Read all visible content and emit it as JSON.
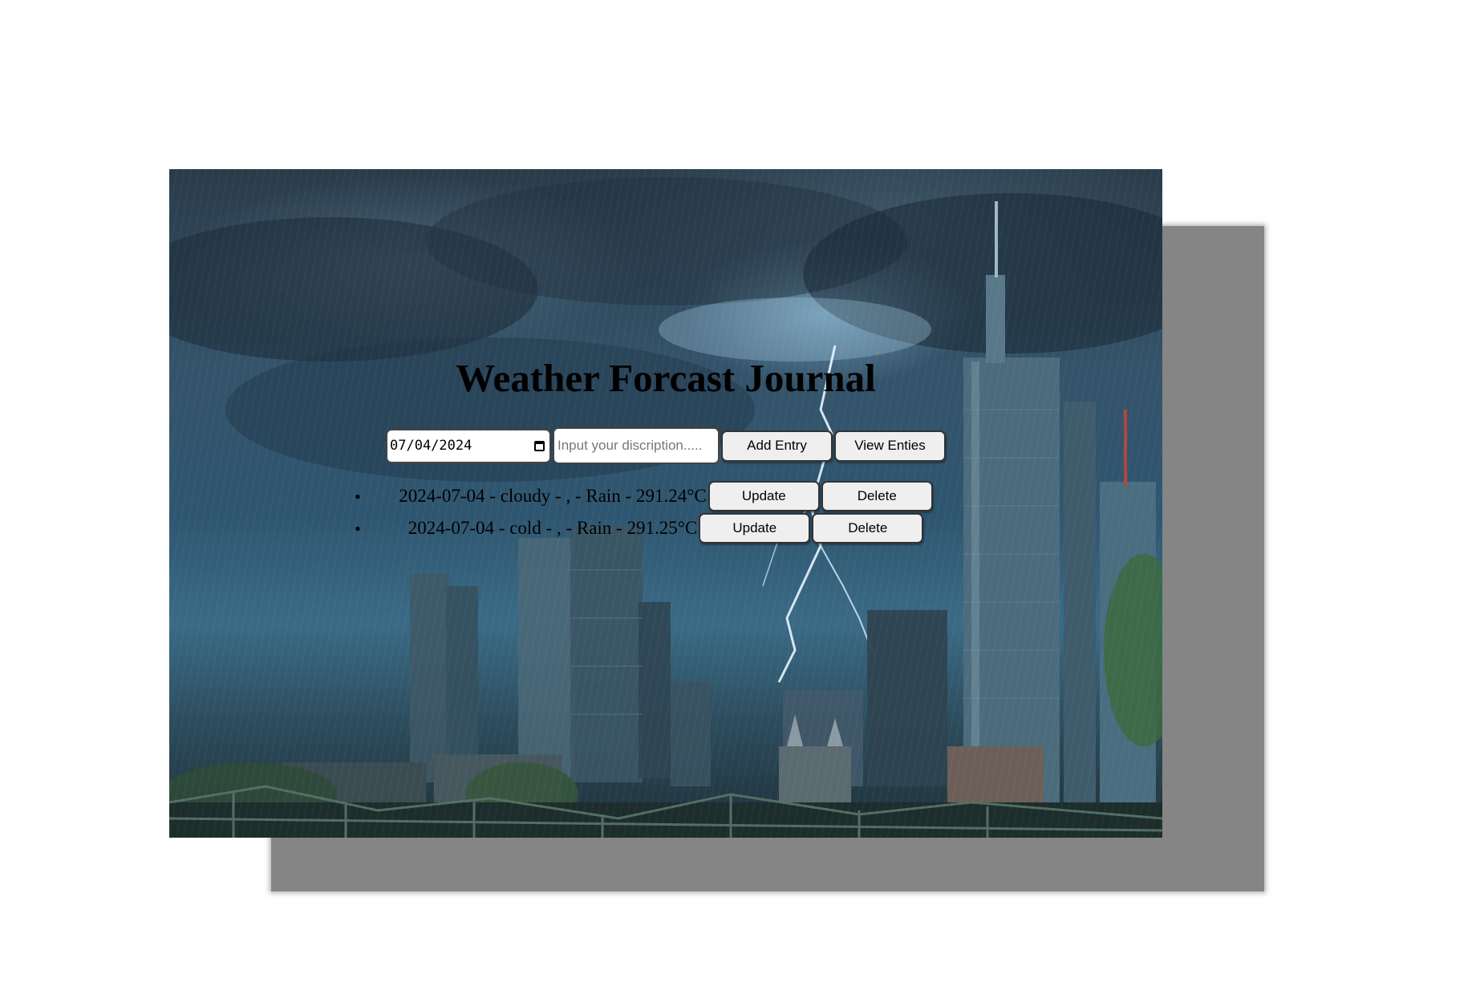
{
  "app": {
    "title": "Weather Forcast Journal"
  },
  "form": {
    "date_value": "07/04/2024",
    "description_placeholder": "Input your discription.....",
    "description_value": "",
    "add_label": "Add Entry",
    "view_label": "View Enties"
  },
  "entries": [
    {
      "text": "2024-07-04 - cloudy - , - Rain - 291.24°C",
      "update_label": "Update",
      "delete_label": "Delete"
    },
    {
      "text": "2024-07-04 - cold - , - Rain - 291.25°C",
      "update_label": "Update",
      "delete_label": "Delete"
    }
  ],
  "icons": {
    "date_picker": "calendar-icon",
    "list_marker": "bullet-icon"
  },
  "colors": {
    "shadow": "#858585",
    "button_bg": "#efefef",
    "text": "#000000"
  }
}
